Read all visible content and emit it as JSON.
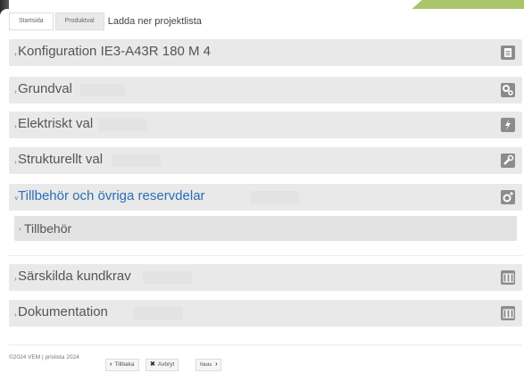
{
  "tabs": {
    "items": [
      {
        "label": "Startsida"
      },
      {
        "label": "Produktval"
      }
    ],
    "title": "Ladda ner projektlista"
  },
  "sections": [
    {
      "label": "Konfiguration IE3-A43R 180 M 4",
      "icon": "document-icon",
      "expanded": false
    },
    {
      "label": "Grundval",
      "icon": "gears-icon",
      "expanded": false
    },
    {
      "label": "Elektriskt val",
      "icon": "lightning-icon",
      "expanded": false
    },
    {
      "label": "Strukturellt val",
      "icon": "wrench-icon",
      "expanded": false
    },
    {
      "label": "Tillbehör och övriga reservdelar",
      "icon": "gear-add-icon",
      "expanded": true
    },
    {
      "label": "Särskilda kundkrav",
      "icon": "binders-icon",
      "expanded": false
    },
    {
      "label": "Dokumentation",
      "icon": "binders-icon",
      "expanded": false
    }
  ],
  "subsection": {
    "label": "Tillbehör"
  },
  "footer": {
    "copyright": "©2024 VEM | prislista 2024"
  },
  "buttons": {
    "back": "Tillbaka",
    "cancel": "Avbryt",
    "next": "Nästa"
  },
  "colors": {
    "accent_green": "#a9c76a",
    "link_blue": "#2a6fb5",
    "row_gray": "#e9e9e9",
    "icon_gray": "#8c8c8c"
  }
}
